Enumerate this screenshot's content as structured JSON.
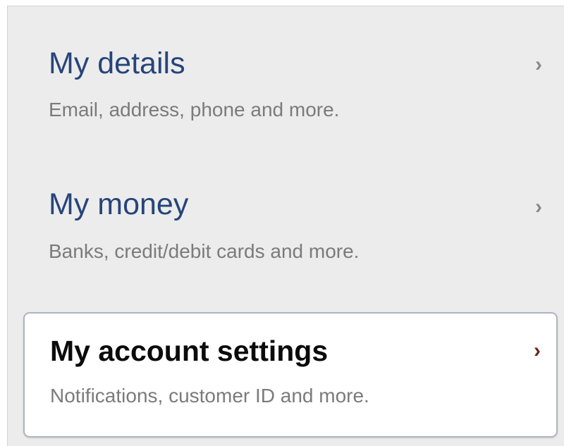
{
  "nav": {
    "items": [
      {
        "title": "My details",
        "description": "Email, address, phone and more.",
        "chevron": "›",
        "icon": "chevron-right-icon"
      },
      {
        "title": "My money",
        "description": "Banks, credit/debit cards and more.",
        "chevron": "›",
        "icon": "chevron-right-icon"
      },
      {
        "title": "My account settings",
        "description": "Notifications, customer ID and more.",
        "chevron": "›",
        "icon": "chevron-right-icon",
        "selected": true
      }
    ]
  },
  "colors": {
    "panel_background": "#ececec",
    "title_blue": "#27447a",
    "description_gray": "#7b7b7b",
    "selected_title": "#0b0b0b",
    "selected_chevron": "#6b2a1a",
    "selected_border": "#aeb4c2"
  }
}
